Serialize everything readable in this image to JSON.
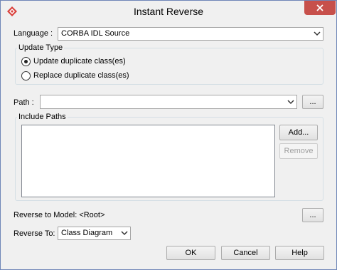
{
  "window": {
    "title": "Instant Reverse"
  },
  "language": {
    "label": "Language :",
    "value": "CORBA IDL Source"
  },
  "update_type": {
    "title": "Update Type",
    "options": [
      {
        "label": "Update duplicate class(es)",
        "selected": true
      },
      {
        "label": "Replace duplicate class(es)",
        "selected": false
      }
    ]
  },
  "path": {
    "label": "Path :",
    "value": "",
    "browse_label": "..."
  },
  "include_paths": {
    "title": "Include Paths",
    "items": [],
    "add_label": "Add...",
    "remove_label": "Remove"
  },
  "reverse_to_model": {
    "label": "Reverse to Model: <Root>",
    "browse_label": "..."
  },
  "reverse_to": {
    "label": "Reverse To:",
    "value": "Class Diagram"
  },
  "buttons": {
    "ok": "OK",
    "cancel": "Cancel",
    "help": "Help"
  },
  "colors": {
    "close_button": "#c7504b",
    "app_icon": "#d9413c"
  }
}
